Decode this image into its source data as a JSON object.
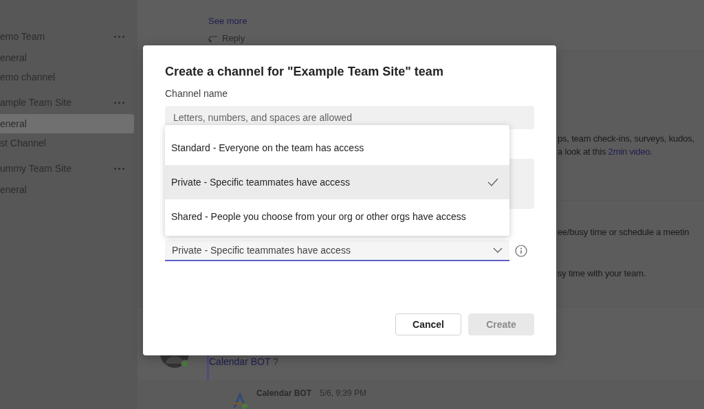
{
  "sidebar": {
    "items": [
      {
        "kind": "team",
        "label": "emo Team",
        "selected": false
      },
      {
        "kind": "channel",
        "label": "eneral",
        "selected": false
      },
      {
        "kind": "channel",
        "label": "emo channel",
        "selected": false
      },
      {
        "kind": "team",
        "label": "ample Team Site",
        "selected": false
      },
      {
        "kind": "channel",
        "label": "eneral",
        "selected": true
      },
      {
        "kind": "channel",
        "label": "st Channel",
        "selected": false
      },
      {
        "kind": "team",
        "label": "ummy Team Site",
        "selected": false
      },
      {
        "kind": "channel",
        "label": "eneral",
        "selected": false
      }
    ]
  },
  "feed": {
    "first_post": {
      "link": "See more",
      "reply": "Reply"
    },
    "second_post": {
      "lines": [
        {
          "text": "ps, team check-ins, surveys, kudos,"
        },
        {
          "text": "a look at this ",
          "link": "2min video."
        }
      ]
    },
    "third_post": {
      "lines": [
        {
          "text": "ee/busy time or schedule a meetin"
        },
        {
          "text": "sy time with your team."
        }
      ]
    },
    "message": {
      "mention": "Calendar BOT",
      "text": " ?"
    },
    "bot_reply": {
      "author": "Calendar BOT",
      "time": "5/6, 9:39 PM"
    }
  },
  "dialog": {
    "title": "Create a channel for \"Example Team Site\" team",
    "channel_name": {
      "label": "Channel name",
      "placeholder": "Letters, numbers, and spaces are allowed"
    },
    "privacy": {
      "value": "Private - Specific teammates have access",
      "expanded": true,
      "options": [
        {
          "label": "Standard - Everyone on the team has access",
          "selected": false
        },
        {
          "label": "Private - Specific teammates have access",
          "selected": true
        },
        {
          "label": "Shared - People you choose from your org or other orgs have access",
          "selected": false
        }
      ]
    },
    "buttons": [
      {
        "label": "Cancel",
        "disabled": false
      },
      {
        "label": "Create",
        "disabled": true
      }
    ]
  }
}
